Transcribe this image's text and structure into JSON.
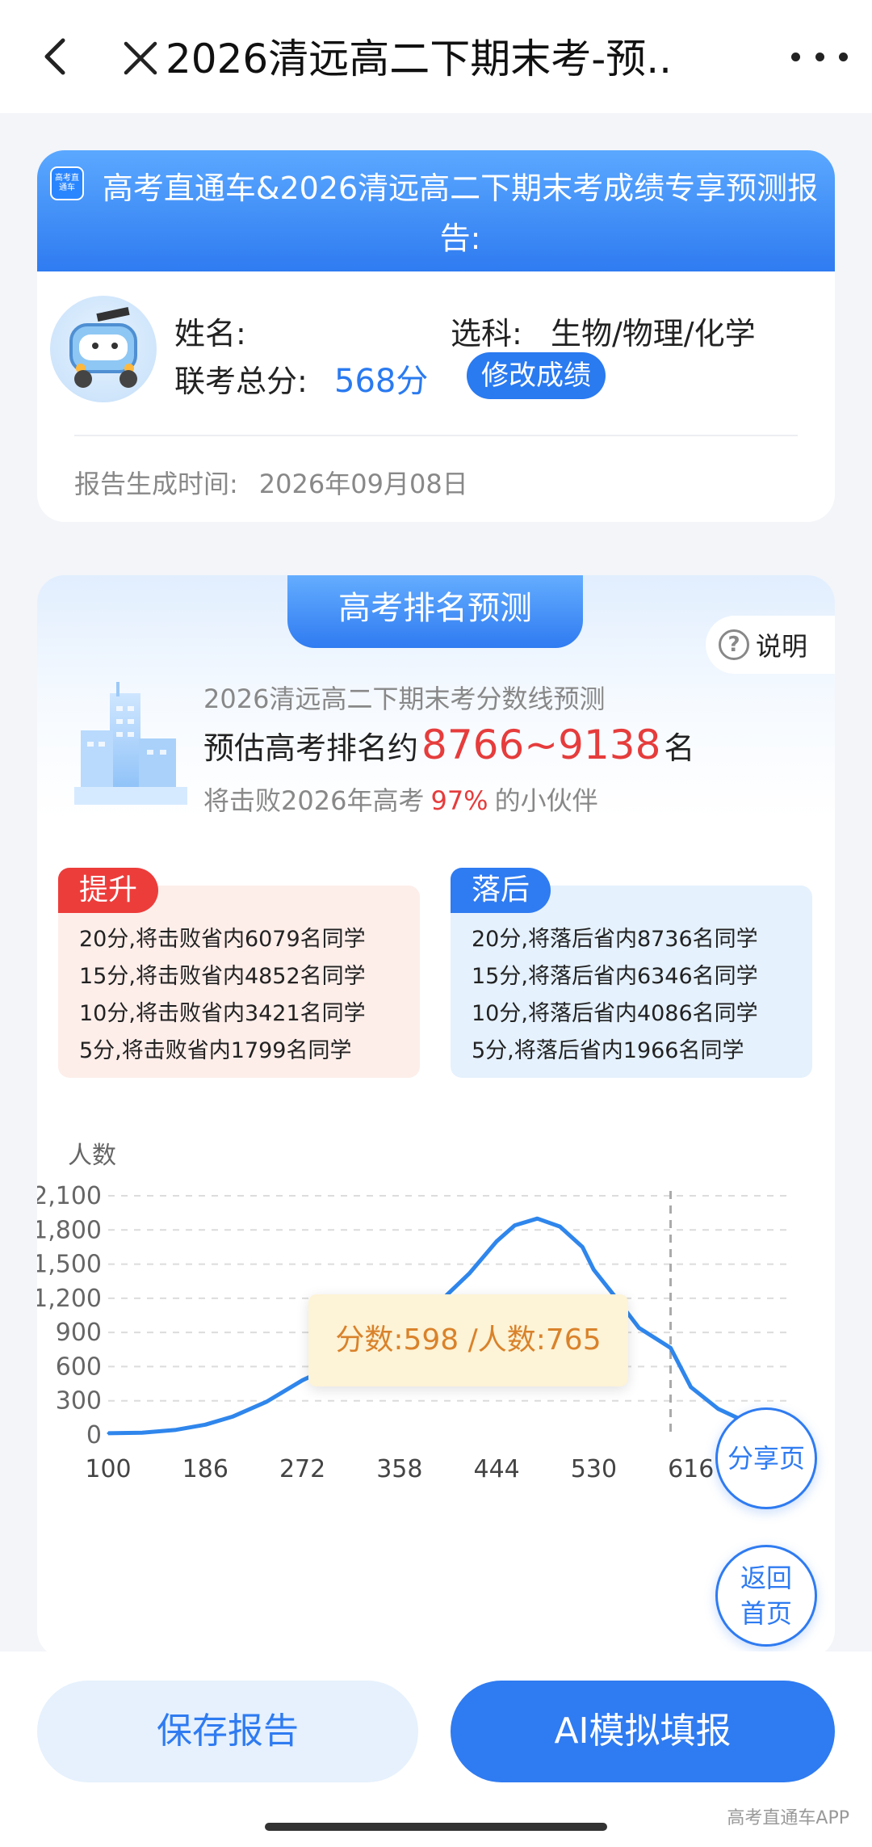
{
  "nav": {
    "title": "2026清远高二下期末考-预.."
  },
  "report": {
    "app_logo_text": "高考直通车",
    "header_title": "高考直通车&2026清远高二下期末考成绩专享预测报告:",
    "name_label": "姓名:",
    "name_value": "",
    "subjects_label": "选科:",
    "subjects_value": "生物/物理/化学",
    "total_label": "联考总分:",
    "total_value": "568分",
    "edit_button": "修改成绩",
    "gen_time_label": "报告生成时间:",
    "gen_time_value": "2026年09月08日"
  },
  "rank": {
    "tab_label": "高考排名预测",
    "explain_label": "说明",
    "line1": "2026清远高二下期末考分数线预测",
    "line2_prefix": "预估高考排名约",
    "rank_range": "8766~9138",
    "line2_suffix": "名",
    "line3_prefix": "将击败2026年高考",
    "beat_pct": "97%",
    "line3_suffix": "的小伙伴"
  },
  "up_box": {
    "tag": "提升",
    "items": [
      "20分,将击败省内6079名同学",
      "15分,将击败省内4852名同学",
      "10分,将击败省内3421名同学",
      "5分,将击败省内1799名同学"
    ]
  },
  "down_box": {
    "tag": "落后",
    "items": [
      "20分,将落后省内8736名同学",
      "15分,将落后省内6346名同学",
      "10分,将落后省内4086名同学",
      "5分,将落后省内1966名同学"
    ]
  },
  "chart_data": {
    "type": "line",
    "title": "",
    "ylabel": "人数",
    "xlabel": "",
    "x_ticks": [
      "100",
      "186",
      "272",
      "358",
      "444",
      "530",
      "616"
    ],
    "y_ticks": [
      "0",
      "300",
      "600",
      "900",
      "1,200",
      "1,500",
      "1,800",
      "2,100"
    ],
    "xlim": [
      100,
      702
    ],
    "ylim": [
      0,
      2100
    ],
    "grid": true,
    "marker_x": 598,
    "series": [
      {
        "x": [
          100,
          130,
          160,
          186,
          210,
          240,
          272,
          300,
          330,
          358,
          380,
          400,
          420,
          444,
          460,
          480,
          500,
          520,
          530,
          550,
          570,
          598,
          616,
          640,
          670,
          700
        ],
        "y": [
          15,
          20,
          45,
          90,
          160,
          290,
          480,
          610,
          760,
          880,
          1020,
          1230,
          1420,
          1700,
          1840,
          1900,
          1830,
          1650,
          1450,
          1200,
          940,
          765,
          420,
          230,
          90,
          20
        ]
      }
    ],
    "tooltip": "分数:598 /人数:765"
  },
  "float": {
    "share": "分享页",
    "home": "返回首页"
  },
  "bottom": {
    "save": "保存报告",
    "ai": "AI模拟填报"
  },
  "watermark": "高考直通车APP",
  "colors": {
    "primary": "#2f7bf1",
    "red": "#e63c3c"
  }
}
